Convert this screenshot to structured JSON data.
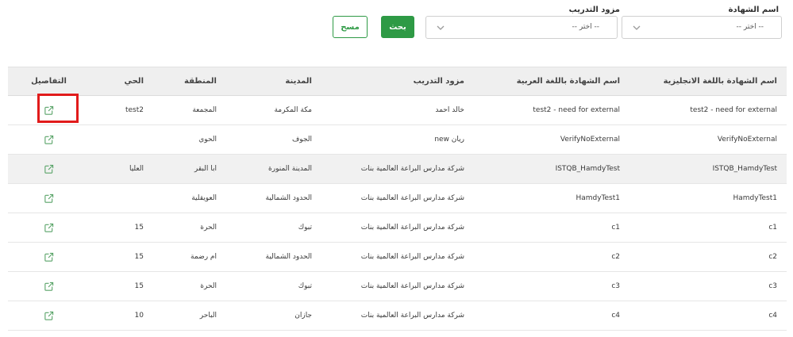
{
  "filters": {
    "certificate_label": "اسم الشهادة",
    "certificate_value": "-- اختر --",
    "provider_label": "مزود التدريب",
    "provider_value": "-- اختر --",
    "search_button": "بحث",
    "clear_button": "مسح"
  },
  "table": {
    "columns": {
      "name_en": "اسم الشهادة باللغة الانجليزية",
      "name_ar": "اسم الشهادة باللغة العربية",
      "provider": "مزود التدريب",
      "city": "المدينة",
      "region": "المنطقة",
      "district": "الحي",
      "details": "التفاصيل"
    },
    "rows": [
      {
        "name_en": "test2 - need for external",
        "name_ar": "test2 - need for external",
        "provider": "خالد احمد",
        "city": "مكة المكرمة",
        "region": "المجمعة",
        "district": "test2"
      },
      {
        "name_en": "VerifyNoExternal",
        "name_ar": "VerifyNoExternal",
        "provider": "ريان new",
        "city": "الجوف",
        "region": "الحوي",
        "district": ""
      },
      {
        "name_en": "ISTQB_HamdyTest",
        "name_ar": "ISTQB_HamdyTest",
        "provider": "شركة مدارس البراعة العالمية بنات",
        "city": "المدينة المنورة",
        "region": "ابا البقر",
        "district": "العليا"
      },
      {
        "name_en": "HamdyTest1",
        "name_ar": "HamdyTest1",
        "provider": "شركة مدارس البراعة العالمية بنات",
        "city": "الحدود الشمالية",
        "region": "العويقلية",
        "district": ""
      },
      {
        "name_en": "c1",
        "name_ar": "c1",
        "provider": "شركة مدارس البراعة العالمية بنات",
        "city": "تبوك",
        "region": "الحرة",
        "district": "15"
      },
      {
        "name_en": "c2",
        "name_ar": "c2",
        "provider": "شركة مدارس البراعة العالمية بنات",
        "city": "الحدود الشمالية",
        "region": "ام رضمة",
        "district": "15"
      },
      {
        "name_en": "c3",
        "name_ar": "c3",
        "provider": "شركة مدارس البراعة العالمية بنات",
        "city": "تبوك",
        "region": "الحرة",
        "district": "15"
      },
      {
        "name_en": "c4",
        "name_ar": "c4",
        "provider": "شركة مدارس البراعة العالمية بنات",
        "city": "جازان",
        "region": "الباحر",
        "district": "10"
      }
    ]
  },
  "icons": {
    "select_chevron": "chevron-down-icon",
    "details": "external-link-icon"
  },
  "colors": {
    "primary_green": "#2e9a45",
    "highlight_red": "#e11b1b",
    "header_bg": "#efefef"
  }
}
